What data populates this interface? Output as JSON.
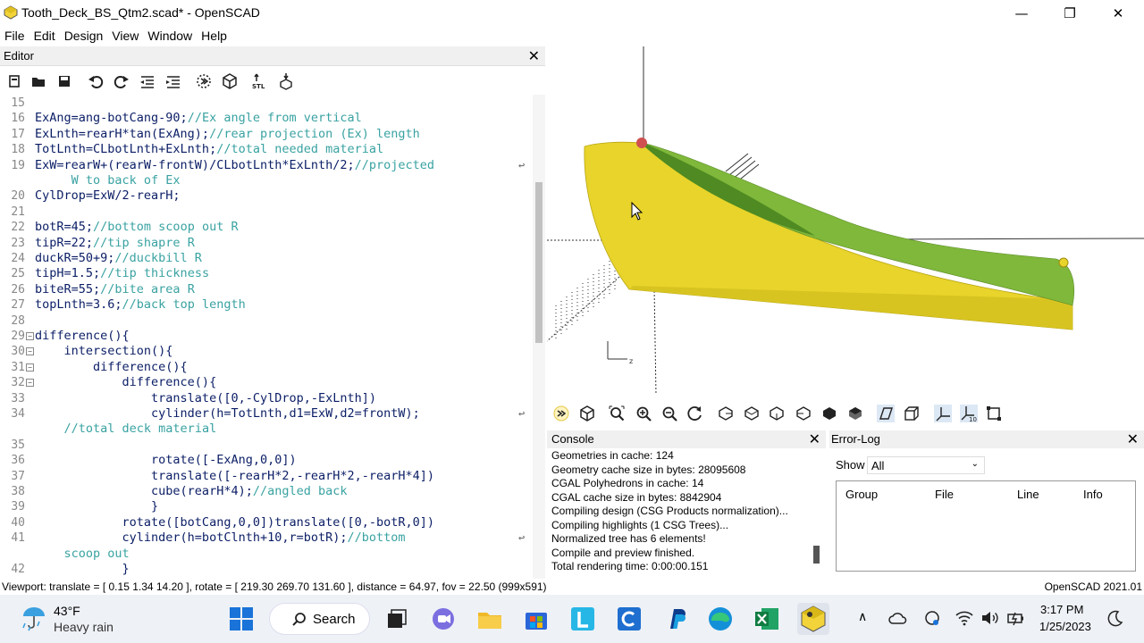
{
  "window": {
    "title": "Tooth_Deck_BS_Qtm2.scad* - OpenSCAD",
    "minimize": "—",
    "maximize": "❐",
    "close": "✕"
  },
  "menu": [
    "File",
    "Edit",
    "Design",
    "View",
    "Window",
    "Help"
  ],
  "editor": {
    "title": "Editor",
    "close": "✕",
    "lines": [
      {
        "n": "15",
        "code": "",
        "comment": ""
      },
      {
        "n": "16",
        "code": "ExAng=ang-botCang-90;",
        "comment": "//Ex angle from vertical"
      },
      {
        "n": "17",
        "code": "ExLnth=rearH*tan(ExAng);",
        "comment": "//rear projection (Ex) length"
      },
      {
        "n": "18",
        "code": "TotLnth=CLbotLnth+ExLnth;",
        "comment": "//total needed material"
      },
      {
        "n": "19",
        "code": "ExW=rearW+(rearW-frontW)/CLbotLnth*ExLnth/2;",
        "comment": "//projected",
        "wrap": true
      },
      {
        "n": "",
        "code": "",
        "comment": "     W to back of Ex"
      },
      {
        "n": "20",
        "code": "CylDrop=ExW/2-rearH;",
        "comment": ""
      },
      {
        "n": "21",
        "code": "",
        "comment": ""
      },
      {
        "n": "22",
        "code": "botR=45;",
        "comment": "//bottom scoop out R"
      },
      {
        "n": "23",
        "code": "tipR=22;",
        "comment": "//tip shapre R"
      },
      {
        "n": "24",
        "code": "duckR=50+9;",
        "comment": "//duckbill R"
      },
      {
        "n": "25",
        "code": "tipH=1.5;",
        "comment": "//tip thickness"
      },
      {
        "n": "26",
        "code": "biteR=55;",
        "comment": "//bite area R"
      },
      {
        "n": "27",
        "code": "topLnth=3.6;",
        "comment": "//back top length"
      },
      {
        "n": "28",
        "code": "",
        "comment": ""
      },
      {
        "n": "29",
        "code": "difference(){",
        "comment": "",
        "fold": true
      },
      {
        "n": "30",
        "code": "    intersection(){",
        "comment": "",
        "fold": true
      },
      {
        "n": "31",
        "code": "        difference(){",
        "comment": "",
        "fold": true
      },
      {
        "n": "32",
        "code": "            difference(){",
        "comment": "",
        "fold": true
      },
      {
        "n": "33",
        "code": "                translate([0,-CylDrop,-ExLnth])",
        "comment": ""
      },
      {
        "n": "34",
        "code": "                cylinder(h=TotLnth,d1=ExW,d2=frontW);",
        "comment": "",
        "wrap": true
      },
      {
        "n": "",
        "code": "    ",
        "comment": "//total deck material"
      },
      {
        "n": "35",
        "code": "",
        "comment": ""
      },
      {
        "n": "36",
        "code": "                rotate([-ExAng,0,0])",
        "comment": ""
      },
      {
        "n": "37",
        "code": "                translate([-rearH*2,-rearH*2,-rearH*4])",
        "comment": ""
      },
      {
        "n": "38",
        "code": "                cube(rearH*4);",
        "comment": "//angled back"
      },
      {
        "n": "39",
        "code": "                }",
        "comment": ""
      },
      {
        "n": "40",
        "code": "            rotate([botCang,0,0])translate([0,-botR,0])",
        "comment": ""
      },
      {
        "n": "41",
        "code": "            cylinder(h=botClnth+10,r=botR);",
        "comment": "//bottom",
        "wrap": true
      },
      {
        "n": "",
        "code": "",
        "comment": "    scoop out"
      },
      {
        "n": "42",
        "code": "            }",
        "comment": ""
      }
    ]
  },
  "console": {
    "title": "Console",
    "close": "✕",
    "lines": [
      "Geometries in cache: 124",
      "Geometry cache size in bytes: 28095608",
      "CGAL Polyhedrons in cache: 14",
      "CGAL cache size in bytes: 8842904",
      "Compiling design (CSG Products normalization)...",
      "Compiling highlights (1 CSG Trees)...",
      "Normalized tree has 6 elements!",
      "Compile and preview finished.",
      "Total rendering time: 0:00:00.151"
    ]
  },
  "errorlog": {
    "title": "Error-Log",
    "close": "✕",
    "show_label": "Show",
    "show_value": "All",
    "columns": [
      "Group",
      "File",
      "Line",
      "Info"
    ]
  },
  "statusbar": {
    "viewport": "Viewport: translate = [ 0.15 1.34 14.20 ], rotate = [ 219.30 269.70 131.60 ], distance = 64.97, fov = 22.50 (999x591)",
    "version": "OpenSCAD 2021.01"
  },
  "viewport": {
    "axis_label": "z",
    "colors": {
      "yellow": "#e8d42a",
      "green": "#7fb83a",
      "dark_green": "#4f8a22"
    }
  },
  "taskbar": {
    "weather_temp": "43°F",
    "weather_desc": "Heavy rain",
    "search_label": "Search",
    "time": "3:17 PM",
    "date": "1/25/2023"
  }
}
